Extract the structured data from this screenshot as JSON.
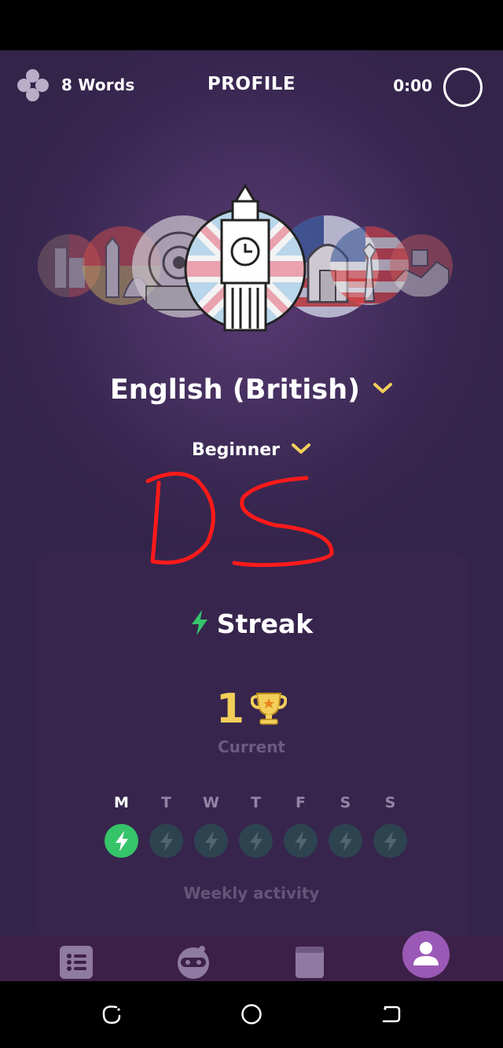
{
  "header": {
    "words_label": "8 Words",
    "title": "PROFILE",
    "timer": "0:00"
  },
  "language": {
    "name": "English (British)",
    "level": "Beginner",
    "flag_icon": "big-ben-union-jack-icon"
  },
  "annotation": {
    "handwritten_text": "DS",
    "color": "#ff1a1a"
  },
  "streak": {
    "title": "Streak",
    "current_count": "1",
    "current_label": "Current",
    "days": [
      {
        "letter": "M",
        "active": true
      },
      {
        "letter": "T",
        "active": false
      },
      {
        "letter": "W",
        "active": false
      },
      {
        "letter": "T",
        "active": false
      },
      {
        "letter": "F",
        "active": false
      },
      {
        "letter": "S",
        "active": false
      },
      {
        "letter": "S",
        "active": false
      }
    ],
    "weekly_label": "Weekly activity"
  },
  "nav": {
    "items": [
      "list-icon",
      "robot-icon",
      "book-icon",
      "profile-icon"
    ],
    "active": "profile-icon"
  },
  "colors": {
    "accent_yellow": "#f3cf5a",
    "streak_green": "#35c46a",
    "profile_purple": "#9b59b6"
  }
}
